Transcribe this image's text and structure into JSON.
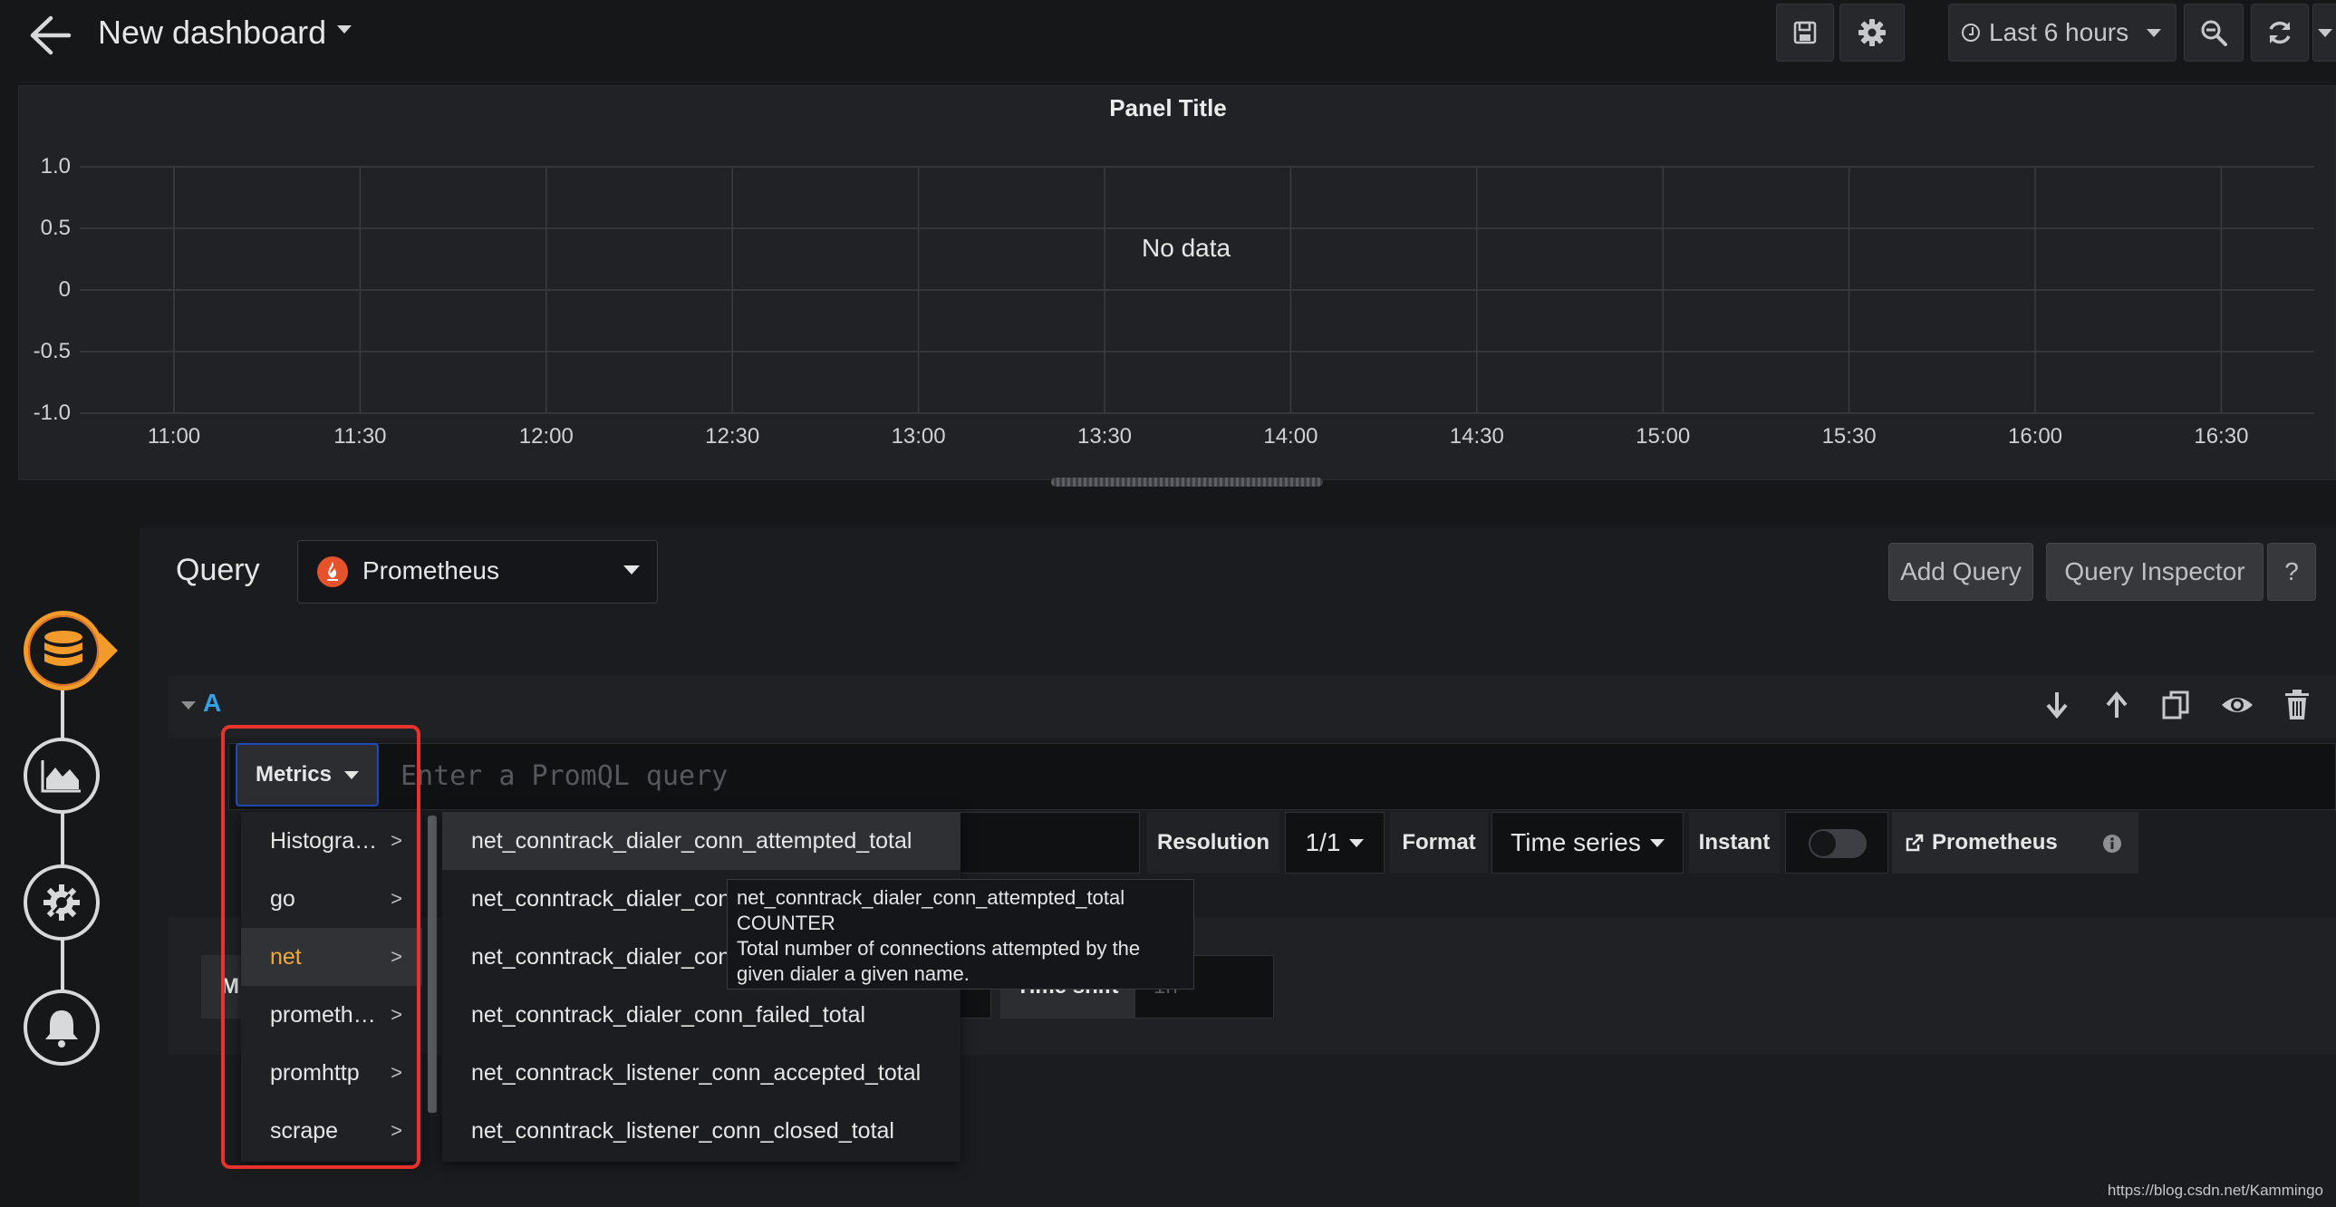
{
  "header": {
    "title": "New dashboard",
    "time_range": "Last 6 hours"
  },
  "panel": {
    "title": "Panel Title",
    "no_data": "No data",
    "y_ticks": [
      "1.0",
      "0.5",
      "0",
      "-0.5",
      "-1.0"
    ],
    "x_ticks": [
      "11:00",
      "11:30",
      "12:00",
      "12:30",
      "13:00",
      "13:30",
      "14:00",
      "14:30",
      "15:00",
      "15:30",
      "16:00",
      "16:30"
    ]
  },
  "query_editor": {
    "label": "Query",
    "datasource": "Prometheus",
    "add_query": "Add Query",
    "query_inspector": "Query Inspector",
    "help": "?"
  },
  "query_row": {
    "ref_id": "A",
    "metrics_button": "Metrics",
    "placeholder": "Enter a PromQL query",
    "resolution_label": "Resolution",
    "resolution_value": "1/1",
    "format_label": "Format",
    "format_value": "Time series",
    "instant_label": "Instant",
    "datasource_link": "Prometheus"
  },
  "metrics_menu": {
    "categories": [
      "Histogra…",
      "go",
      "net",
      "prometh…",
      "promhttp",
      "scrape"
    ],
    "chevron": ">",
    "metrics": [
      "net_conntrack_dialer_conn_attempted_total",
      "net_conntrack_dialer_conn",
      "net_conntrack_dialer_conn",
      "net_conntrack_dialer_conn_failed_total",
      "net_conntrack_listener_conn_accepted_total",
      "net_conntrack_listener_conn_closed_total"
    ]
  },
  "tooltip": {
    "name": "net_conntrack_dialer_conn_attempted_total",
    "type": "COUNTER",
    "help_line1": "Total number of connections attempted by the",
    "help_line2": "given dialer a given name."
  },
  "options_row": {
    "min_prefix": "M",
    "time_shift_label": "Time shift",
    "time_shift_placeholder": "1h"
  },
  "watermark": "https://blog.csdn.net/Kammingo",
  "colors": {
    "accent_orange": "#f29a2a",
    "ref_blue": "#33a2e5",
    "highlight_red": "#e8332c",
    "prometheus_red": "#e6522c"
  }
}
